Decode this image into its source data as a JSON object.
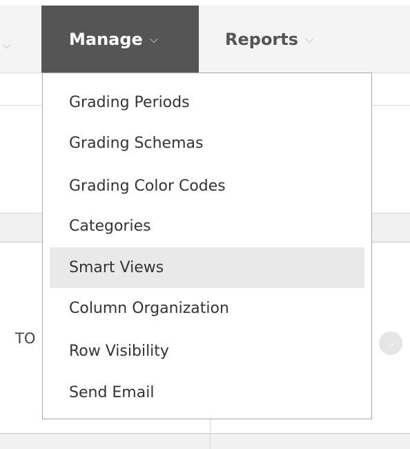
{
  "nav": {
    "items": [
      {
        "label": "Manage",
        "chevron": "⌵",
        "active": true
      },
      {
        "label": "Reports",
        "chevron": "⌵",
        "active": false
      }
    ],
    "partial_left_chevron": "⌵"
  },
  "dropdown": {
    "items": [
      {
        "label": "Grading Periods"
      },
      {
        "label": "Grading Schemas"
      },
      {
        "label": "Grading Color Codes"
      },
      {
        "label": "Categories"
      },
      {
        "label": "Smart Views",
        "highlighted": true
      },
      {
        "label": "Column Organization"
      },
      {
        "label": "Row Visibility"
      },
      {
        "label": "Send Email"
      }
    ]
  },
  "background": {
    "partial_cell_text": "TO",
    "row_menu_icon": "circle-chevron-down-icon"
  },
  "colors": {
    "nav_active_bg": "#555555",
    "nav_bg": "#f4f4f4",
    "menu_hover_bg": "#e9e9e9",
    "menu_border": "#aaaaaa"
  }
}
